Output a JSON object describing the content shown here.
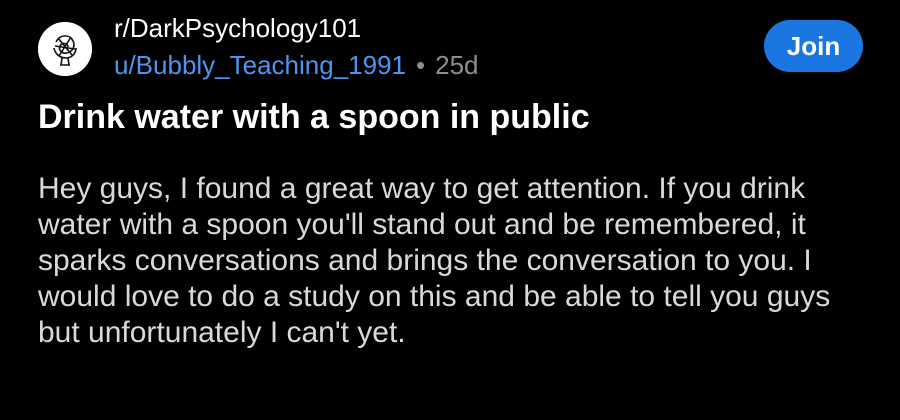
{
  "post": {
    "subreddit": "r/DarkPsychology101",
    "username": "u/Bubbly_Teaching_1991",
    "separator": "•",
    "age": "25d",
    "join_label": "Join",
    "title": "Drink water with a spoon in public",
    "body": "Hey guys, I found a great way to get attention. If you drink water with a spoon you'll stand out and be remembered, it sparks conversations and brings the conversation to you. I would love to do a study on this and be able to tell you guys but unfortunately I can't yet."
  },
  "colors": {
    "background": "#000000",
    "username": "#4e94f2",
    "join_button": "#1a76e0",
    "meta_gray": "#8b8f93"
  },
  "icons": {
    "avatar": "subreddit-avatar-icon"
  }
}
